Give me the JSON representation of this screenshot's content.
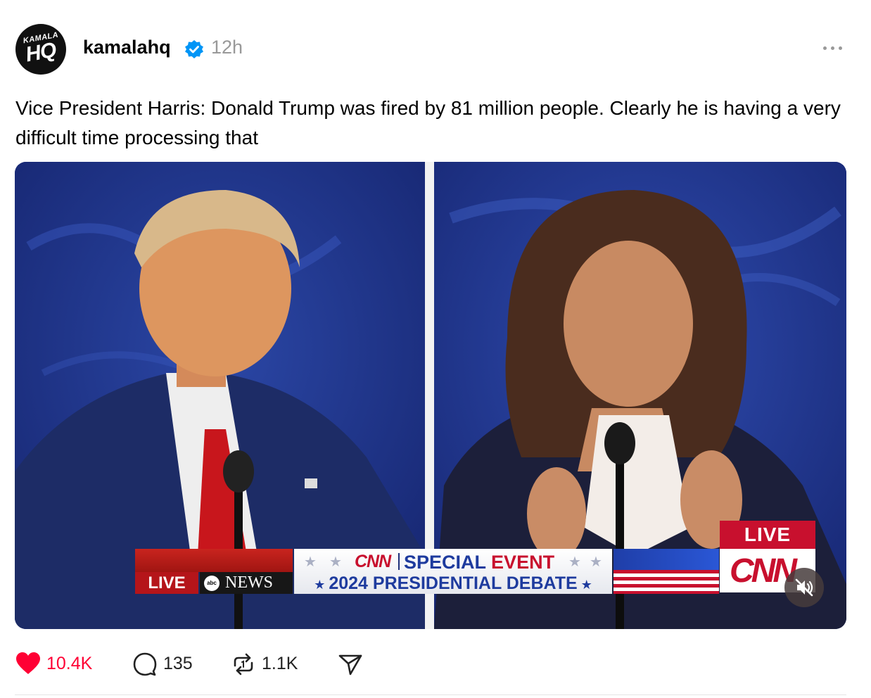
{
  "post": {
    "avatar_text_top": "KAMALA",
    "avatar_text_main": "HQ",
    "username": "kamalahq",
    "verified_icon": "verified-badge-icon",
    "timestamp": "12h",
    "more_icon": "more-horizontal-icon",
    "text": "Vice President Harris: Donald Trump was fired by 81 million people. Clearly he is having a very difficult time processing that"
  },
  "video": {
    "lower_third": {
      "live": "LIVE",
      "abc_logo": "abc",
      "abc_news": "NEWS",
      "cnn": "CNN",
      "special": "SPECIAL",
      "event": "EVENT",
      "debate": "2024 PRESIDENTIAL DEBATE"
    },
    "live_badge": "LIVE",
    "cnn_badge": "CNN",
    "mute_icon": "muted-speaker-icon"
  },
  "actions": {
    "like": {
      "icon": "heart-filled-icon",
      "count": "10.4K",
      "color": "#ff0034"
    },
    "reply": {
      "icon": "comment-icon",
      "count": "135"
    },
    "repost": {
      "icon": "repost-icon",
      "count": "1.1K"
    },
    "share": {
      "icon": "send-icon"
    }
  },
  "colors": {
    "verified": "#0095f6",
    "muted_text": "#999999",
    "cnn_red": "#c8102e",
    "cnn_blue": "#1e3b9e"
  }
}
